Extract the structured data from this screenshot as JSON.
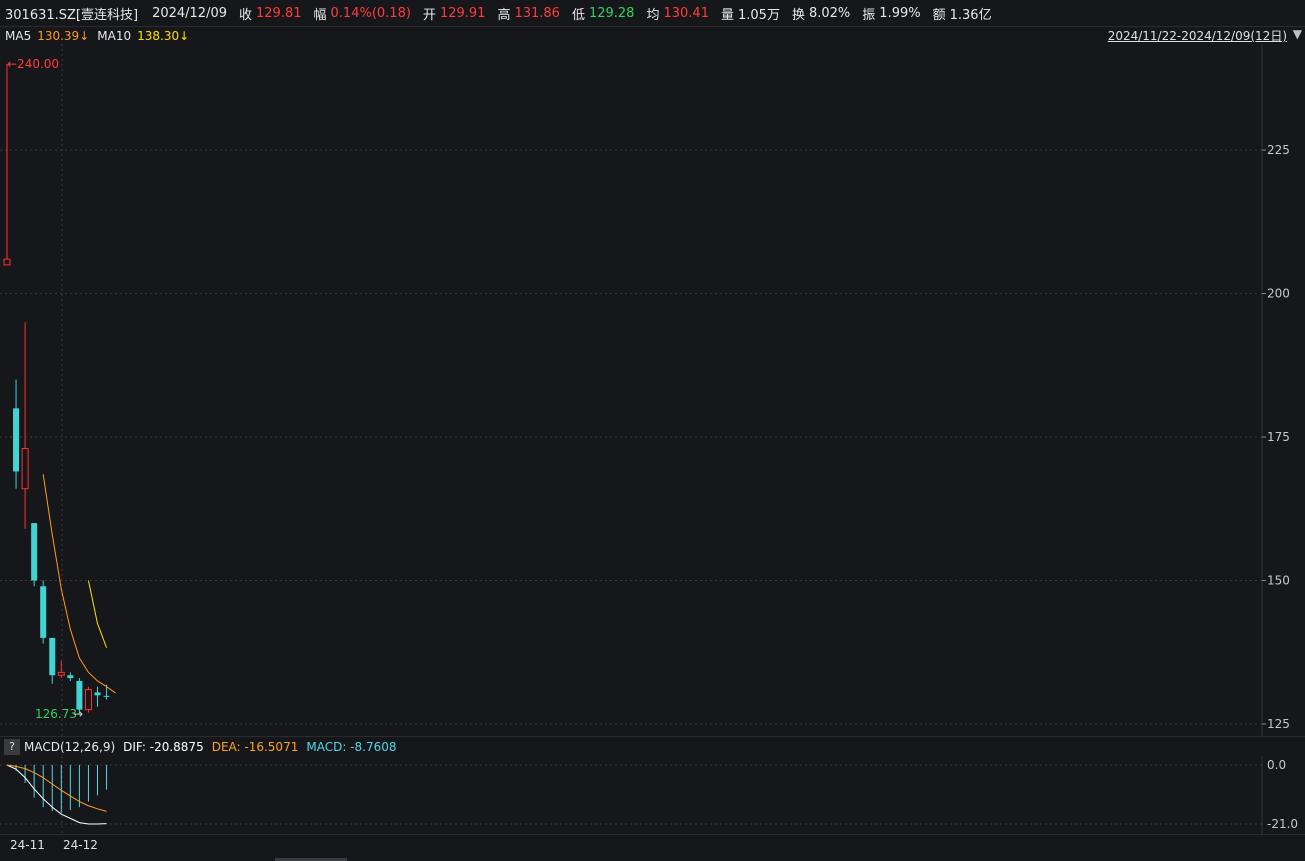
{
  "header": {
    "code": "301631.SZ[壹连科技]",
    "date": "2024/12/09",
    "close_label": "收",
    "close": "129.81",
    "change_label": "幅",
    "change": "0.14%(0.18)",
    "open_label": "开",
    "open": "129.91",
    "high_label": "高",
    "high": "131.86",
    "low_label": "低",
    "low": "129.28",
    "avg_label": "均",
    "avg": "130.41",
    "vol_label": "量",
    "vol": "1.05万",
    "turnover_label": "换",
    "turnover": "8.02%",
    "amplitude_label": "振",
    "amplitude": "1.99%",
    "amount_label": "额",
    "amount": "1.36亿"
  },
  "ma": {
    "ma5_label": "MA5",
    "ma5_value": "130.39↓",
    "ma10_label": "MA10",
    "ma10_value": "138.30↓",
    "range": "2024/11/22-2024/12/09(12日)",
    "range_arrow": "▼"
  },
  "macd_header": {
    "help": "?",
    "name": "MACD(12,26,9)",
    "dif": "DIF: -20.8875",
    "dea": "DEA: -16.5071",
    "macd": "MACD: -8.7608"
  },
  "x_axis": {
    "labels": [
      "24-11",
      "24-12"
    ]
  },
  "chart_data": [
    {
      "type": "candlestick",
      "title": "",
      "ylim": [
        125,
        240
      ],
      "yticks": [
        125,
        150,
        175,
        200,
        225
      ],
      "annotations": {
        "high_mark": "240.00",
        "low_mark": "126.73"
      },
      "candles": [
        {
          "o": 206,
          "c": 205,
          "h": 240,
          "l": 205,
          "up": true
        },
        {
          "o": 180,
          "c": 169,
          "h": 185,
          "l": 166,
          "up": false
        },
        {
          "o": 166,
          "c": 173,
          "h": 195,
          "l": 159,
          "up": true
        },
        {
          "o": 160,
          "c": 150,
          "h": 160,
          "l": 149,
          "up": false
        },
        {
          "o": 149,
          "c": 140,
          "h": 150,
          "l": 139,
          "up": false
        },
        {
          "o": 140,
          "c": 133.5,
          "h": 140,
          "l": 132,
          "up": false
        },
        {
          "o": 133.5,
          "c": 134,
          "h": 136,
          "l": 133,
          "up": true
        },
        {
          "o": 133.5,
          "c": 133.0,
          "h": 134,
          "l": 132.5,
          "up": false
        },
        {
          "o": 132.5,
          "c": 127.5,
          "h": 133,
          "l": 126.73,
          "up": false
        },
        {
          "o": 127.5,
          "c": 131,
          "h": 131.5,
          "l": 127,
          "up": true
        },
        {
          "o": 130.5,
          "c": 130.0,
          "h": 131.5,
          "l": 128,
          "up": false
        },
        {
          "o": 129.91,
          "c": 129.81,
          "h": 131.86,
          "l": 129.28,
          "up": false
        }
      ],
      "series": [
        {
          "name": "MA5",
          "color": "#ff9a1f",
          "start": 4,
          "values": [
            168.5,
            158.0,
            148.5,
            141.5,
            136.5,
            134.0,
            132.5,
            131.5,
            130.39
          ]
        },
        {
          "name": "MA10",
          "color": "#ffe100",
          "start": 9,
          "values": [
            150.0,
            142.5,
            138.3
          ]
        }
      ]
    },
    {
      "type": "macd",
      "ylim": [
        -21.0,
        0.0
      ],
      "yticks": [
        0.0,
        -21.0
      ],
      "dif": [
        0,
        -1.5,
        -4.5,
        -8.5,
        -12,
        -15,
        -17.5,
        -19,
        -20.5,
        -21,
        -21,
        -20.8875
      ],
      "dea": [
        0,
        -0.5,
        -1.3,
        -2.7,
        -4.5,
        -6.8,
        -9,
        -11,
        -13,
        -14.5,
        -15.6,
        -16.5071
      ],
      "macd": [
        0,
        -2,
        -6.4,
        -11.6,
        -15,
        -16.4,
        -17,
        -16,
        -15,
        -13,
        -10.8,
        -8.7608
      ],
      "colors": {
        "dif": "#ffffff",
        "dea": "#ffa020",
        "macd": "#53d6e8"
      }
    }
  ]
}
